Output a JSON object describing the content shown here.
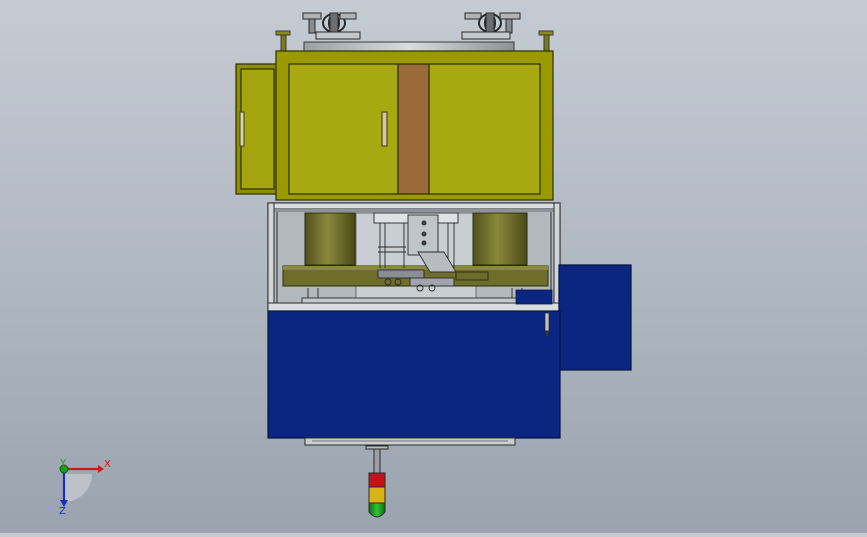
{
  "viewport": {
    "background_top": "#c4cbd3",
    "background_bottom": "#9aa3ae"
  },
  "triad": {
    "x_label": "X",
    "y_label": "Y",
    "z_label": "Z",
    "x_color": "#d01818",
    "y_color": "#18a018",
    "z_color": "#1830c0"
  },
  "colors": {
    "olive_cabinet": "#9a9a00",
    "olive_face": "#a8a810",
    "brown_center": "#9a6a3a",
    "navy_base": "#0a2680",
    "light_steel": "#c9ced2",
    "dark_olive_cylinder": "#6e6e2a",
    "tower_red": "#c0141a",
    "tower_amber": "#d8b414",
    "tower_green": "#18a018"
  }
}
